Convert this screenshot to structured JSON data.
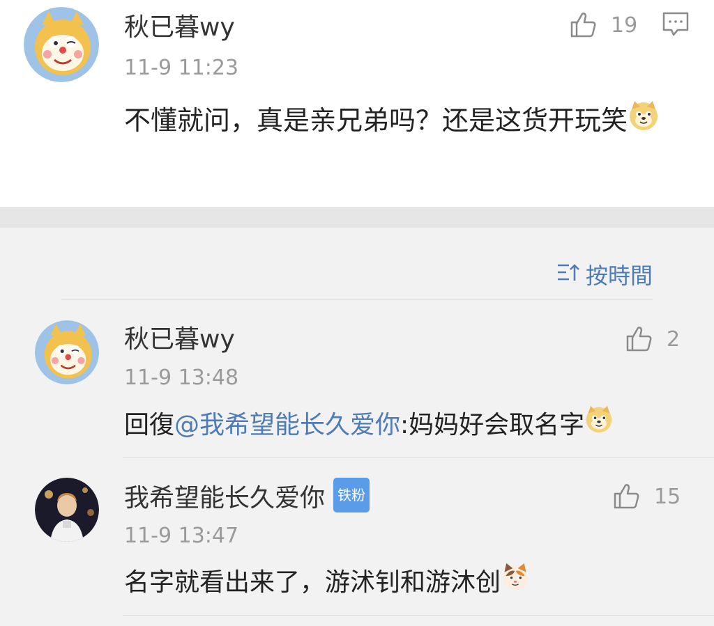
{
  "main_comment": {
    "username": "秋已暮wy",
    "time": "11-9 11:23",
    "likes": "19",
    "text": "不懂就问，真是亲兄弟吗？还是这货开玩笑",
    "emoji": "doge-emoji"
  },
  "sort": {
    "label": "按時間",
    "icon": "sort-icon"
  },
  "replies": [
    {
      "username": "秋已暮wy",
      "time": "11-9 13:48",
      "likes": "2",
      "text_prefix": "回復",
      "mention": "@我希望能长久爱你",
      "text_suffix": ":妈妈好会取名字",
      "emoji": "doge-emoji"
    },
    {
      "username": "我希望能长久爱你",
      "badge": "铁粉",
      "time": "11-9 13:47",
      "likes": "15",
      "text": "名字就看出来了，游沭钊和游沐创",
      "emoji": "cat-emoji"
    }
  ]
}
